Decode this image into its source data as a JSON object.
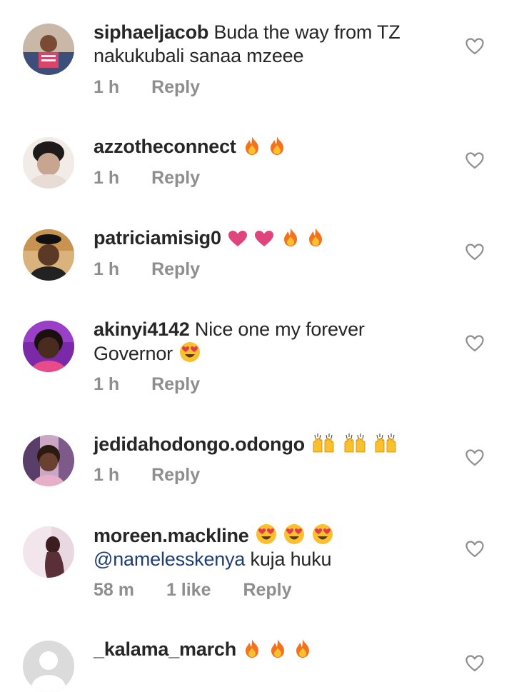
{
  "comments": [
    {
      "username": "siphaeljacob",
      "text": "Buda the way from TZ nakukubali sanaa mzeee",
      "time": "1 h",
      "reply_label": "Reply",
      "emojis": []
    },
    {
      "username": "azzotheconnect",
      "text": "",
      "time": "1 h",
      "reply_label": "Reply",
      "emojis": [
        "fire-icon",
        "fire-icon"
      ]
    },
    {
      "username": "patriciamisig0",
      "text": "",
      "time": "1 h",
      "reply_label": "Reply",
      "emojis": [
        "pink-heart-icon",
        "pink-heart-icon",
        "fire-icon",
        "fire-icon"
      ]
    },
    {
      "username": "akinyi4142",
      "text": "Nice one my forever Governor",
      "time": "1 h",
      "reply_label": "Reply",
      "emojis": [
        "heart-eyes-icon"
      ]
    },
    {
      "username": "jedidahodongo.odongo",
      "text": "",
      "time": "1 h",
      "reply_label": "Reply",
      "emojis": [
        "raised-hands-icon",
        "raised-hands-icon",
        "raised-hands-icon"
      ]
    },
    {
      "username": "moreen.mackline",
      "mention": "@namelesskenya",
      "text": "kuja huku",
      "time": "58 m",
      "likes": "1 like",
      "reply_label": "Reply",
      "emojis": [
        "heart-eyes-icon",
        "heart-eyes-icon",
        "heart-eyes-icon"
      ]
    },
    {
      "username": "_kalama_march",
      "text": "",
      "emojis": [
        "fire-icon",
        "fire-icon",
        "fire-icon"
      ]
    }
  ],
  "colors": {
    "username": "#262626",
    "meta": "#8e8e8e",
    "mention": "#1e3d73",
    "heart_outline": "#8e8e8e"
  }
}
